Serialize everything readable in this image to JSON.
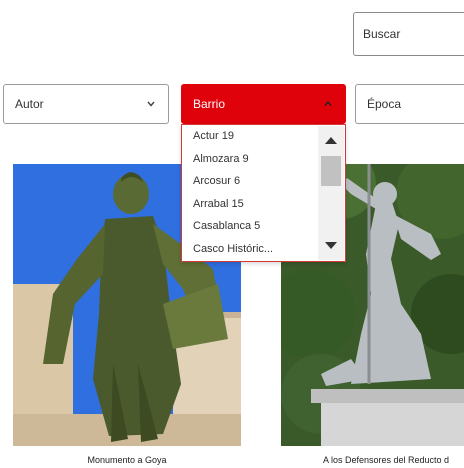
{
  "search": {
    "placeholder": "Buscar"
  },
  "filters": {
    "autor": {
      "label": "Autor"
    },
    "barrio": {
      "label": "Barrio",
      "active_color": "#e0020b",
      "options": [
        "Actur 19",
        "Almozara 9",
        "Arcosur 6",
        "Arrabal 15",
        "Casablanca 5",
        "Casco Históric..."
      ]
    },
    "epoca": {
      "label": "Época"
    }
  },
  "cards": [
    {
      "caption": "Monumento a Goya",
      "image": "goya-statue-photo"
    },
    {
      "caption": "A los Defensores del Reducto d",
      "image": "reducto-statue-photo"
    }
  ]
}
